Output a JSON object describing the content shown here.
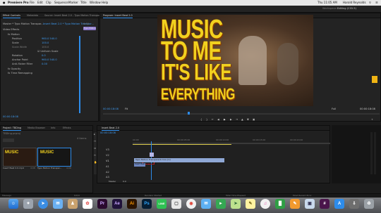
{
  "menubar": {
    "app_name": "Premiere Pro",
    "items": [
      "File",
      "Edit",
      "Clip",
      "Sequence",
      "Marker",
      "Title",
      "Window",
      "Help"
    ],
    "time": "Thu 11:05 AM",
    "user": "Harold Reynolds"
  },
  "workspace": {
    "label": "Workspace:",
    "value": "Editing (CS5.5)"
  },
  "effect_controls": {
    "tabs": [
      "Effect Controls",
      "Metadata",
      "Source: Insert Beat 2.0 - Typo Motion Transparent",
      "Audio Clip Mixer"
    ],
    "source_label": "Master * Typo Motion Transpar...",
    "clip_label": "Insert Beat 2.0 * Typo Motion Transpar...",
    "timecode_top": "0:00",
    "clip_bar_label": "Typo Motion",
    "section": "Video Effects",
    "rows": [
      {
        "name": "Motion",
        "value": ""
      },
      {
        "name": "Position",
        "value": "960.0    540.0"
      },
      {
        "name": "Scale",
        "value": "100.0"
      },
      {
        "name": "Scale Width",
        "value": "100.0"
      },
      {
        "name": "Uniform Scale",
        "value": ""
      },
      {
        "name": "Rotation",
        "value": "0.0"
      },
      {
        "name": "Anchor Point",
        "value": "960.0    540.0"
      },
      {
        "name": "Anti-flicker Filter",
        "value": "0.00"
      },
      {
        "name": "Opacity",
        "value": ""
      },
      {
        "name": "Time Remapping",
        "value": ""
      }
    ],
    "timecode": "00:00:18:08"
  },
  "program": {
    "tab": "Program: Insert Beat 2.0",
    "video_text": [
      "MUSIC",
      "TO ME",
      "IT'S LIKE",
      "EVERYTHING"
    ],
    "timecode_left": "00:00:18:08",
    "fit": "Fit",
    "resolution": "Full",
    "timecode_right": "00:00:18:08"
  },
  "project": {
    "tabs": [
      "Project: TBDing",
      "Media Browser",
      "Info",
      "Effects"
    ],
    "file_label": "TBDing.prproj",
    "count": "4 Items",
    "bins": [
      {
        "label": "Insert Beat 2.0.mp4",
        "thumb_text": "MUSIC",
        "duration": "4:08"
      },
      {
        "label": "Typo Motion Transpar...",
        "thumb_text": "MUSIC",
        "duration": "4:08"
      }
    ]
  },
  "timeline": {
    "tab": "Insert Beat 2.0",
    "timecode": "00:00:18:08",
    "ruler": [
      "00:00",
      "00:00:05:00",
      "00:00:10:00",
      "00:00:15:00",
      "00:00:20:00",
      "00:00:25:00"
    ],
    "video_tracks": [
      "V3",
      "V2",
      "V1"
    ],
    "audio_tracks": [
      "A1",
      "A2",
      "A3"
    ],
    "master_label": "Master",
    "master_value": "0.0",
    "clip_label": "Typo Motion Transparent.mov [V]",
    "clip_label2": "Insert Beat 2.0.mp4 [V]"
  },
  "status_bar": {
    "items": [
      "Message",
      "Kit/Id",
      "Renders Started",
      "Total Time Elapsed",
      "Most Recent Error"
    ]
  },
  "dock": [
    "Finder",
    "Launchpad",
    "Safari",
    "Mail",
    "Contacts",
    "Photos",
    "Calendar",
    "Pr",
    "Ae",
    "Ai",
    "Ps",
    "LINE",
    "Chrome",
    "Keynote",
    "Messages",
    "FaceTime",
    "Maps",
    "Notes",
    "iTunes",
    "Numbers",
    "Pages",
    "Preview",
    "Slack",
    "Store",
    "Trash"
  ],
  "colors": {
    "accent": "#2d8ceb",
    "video_text": "#f1d11f",
    "timeline_clip": "#8fa8d6",
    "selection_box": "#e1262b"
  }
}
